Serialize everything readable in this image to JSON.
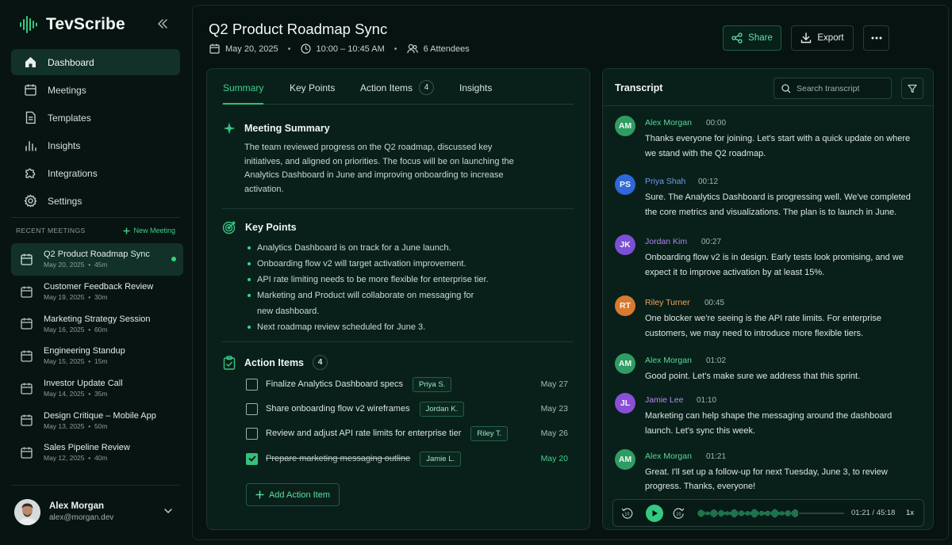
{
  "app": {
    "name": "TevScribe"
  },
  "sidebar": {
    "nav": [
      {
        "label": "Dashboard",
        "icon": "home-icon",
        "active": true
      },
      {
        "label": "Meetings",
        "icon": "calendar-icon"
      },
      {
        "label": "Templates",
        "icon": "document-icon"
      },
      {
        "label": "Insights",
        "icon": "bar-chart-icon"
      },
      {
        "label": "Integrations",
        "icon": "puzzle-icon"
      },
      {
        "label": "Settings",
        "icon": "gear-icon"
      }
    ],
    "recent_label": "RECENT MEETINGS",
    "new_meeting_label": "New Meeting",
    "meetings": [
      {
        "title": "Q2 Product Roadmap Sync",
        "date": "May 20, 2025",
        "duration": "45m",
        "active": true
      },
      {
        "title": "Customer Feedback Review",
        "date": "May 19, 2025",
        "duration": "30m"
      },
      {
        "title": "Marketing Strategy Session",
        "date": "May 16, 2025",
        "duration": "60m"
      },
      {
        "title": "Engineering Standup",
        "date": "May 15, 2025",
        "duration": "15m"
      },
      {
        "title": "Investor Update Call",
        "date": "May 14, 2025",
        "duration": "35m"
      },
      {
        "title": "Design Critique – Mobile App",
        "date": "May 13, 2025",
        "duration": "50m"
      },
      {
        "title": "Sales Pipeline Review",
        "date": "May 12, 2025",
        "duration": "40m"
      }
    ],
    "user": {
      "name": "Alex Morgan",
      "email": "alex@morgan.dev"
    }
  },
  "header": {
    "title": "Q2 Product Roadmap Sync",
    "date": "May 20, 2025",
    "time": "10:00 – 10:45 AM",
    "attendees": "6 Attendees",
    "share_label": "Share",
    "export_label": "Export"
  },
  "tabs": [
    {
      "label": "Summary",
      "active": true
    },
    {
      "label": "Key Points"
    },
    {
      "label": "Action Items",
      "count": "4"
    },
    {
      "label": "Insights"
    }
  ],
  "summary": {
    "heading": "Meeting Summary",
    "text": "The team reviewed progress on the Q2 roadmap, discussed key initiatives, and aligned on priorities. The focus will be on launching the Analytics Dashboard in June and improving onboarding to increase activation."
  },
  "key_points": {
    "heading": "Key Points",
    "items": [
      "Analytics Dashboard is on track for a June launch.",
      "Onboarding flow v2 will target activation improvement.",
      "API rate limiting needs to be more flexible for enterprise tier.",
      "Marketing and Product will collaborate on messaging for new dashboard.",
      "Next roadmap review scheduled for June 3."
    ]
  },
  "action_items": {
    "heading": "Action Items",
    "count": "4",
    "items": [
      {
        "text": "Finalize Analytics Dashboard specs",
        "assignee": "Priya S.",
        "due": "May 27",
        "done": false
      },
      {
        "text": "Share onboarding flow v2 wireframes",
        "assignee": "Jordan K.",
        "due": "May 23",
        "done": false
      },
      {
        "text": "Review and adjust API rate limits for enterprise tier",
        "assignee": "Riley T.",
        "due": "May 26",
        "done": false
      },
      {
        "text": "Prepare marketing messaging outline",
        "assignee": "Jamie L.",
        "due": "May 20",
        "done": true
      }
    ],
    "add_label": "Add Action Item"
  },
  "transcript": {
    "title": "Transcript",
    "search_placeholder": "Search transcript",
    "entries": [
      {
        "initials": "AM",
        "speaker": "Alex Morgan",
        "time": "00:00",
        "color": "#2f9d62",
        "name_color": "#57d898",
        "text": "Thanks everyone for joining. Let's start with a quick update on where we stand with the Q2 roadmap."
      },
      {
        "initials": "PS",
        "speaker": "Priya Shah",
        "time": "00:12",
        "color": "#2f68d8",
        "name_color": "#6f9cf2",
        "text": "Sure. The Analytics Dashboard is progressing well. We've completed the core metrics and visualizations. The plan is to launch in June."
      },
      {
        "initials": "JK",
        "speaker": "Jordan Kim",
        "time": "00:27",
        "color": "#7b4fd6",
        "name_color": "#a987f0",
        "text": "Onboarding flow v2 is in design. Early tests look promising, and we expect it to improve activation by at least 15%."
      },
      {
        "initials": "RT",
        "speaker": "Riley Turner",
        "time": "00:45",
        "color": "#d87a2f",
        "name_color": "#f0a261",
        "text": "One blocker we're seeing is the API rate limits. For enterprise customers, we may need to introduce more flexible tiers."
      },
      {
        "initials": "AM",
        "speaker": "Alex Morgan",
        "time": "01:02",
        "color": "#2f9d62",
        "name_color": "#57d898",
        "text": "Good point. Let's make sure we address that this sprint."
      },
      {
        "initials": "JL",
        "speaker": "Jamie Lee",
        "time": "01:10",
        "color": "#8a4fd6",
        "name_color": "#b388f0",
        "text": "Marketing can help shape the messaging around the dashboard launch. Let's sync this week."
      },
      {
        "initials": "AM",
        "speaker": "Alex Morgan",
        "time": "01:21",
        "color": "#2f9d62",
        "name_color": "#57d898",
        "text": "Great. I'll set up a follow-up for next Tuesday, June 3, to review progress. Thanks, everyone!"
      }
    ],
    "player": {
      "time": "01:21 / 45:18",
      "speed": "1x",
      "progress": 0.03
    }
  }
}
